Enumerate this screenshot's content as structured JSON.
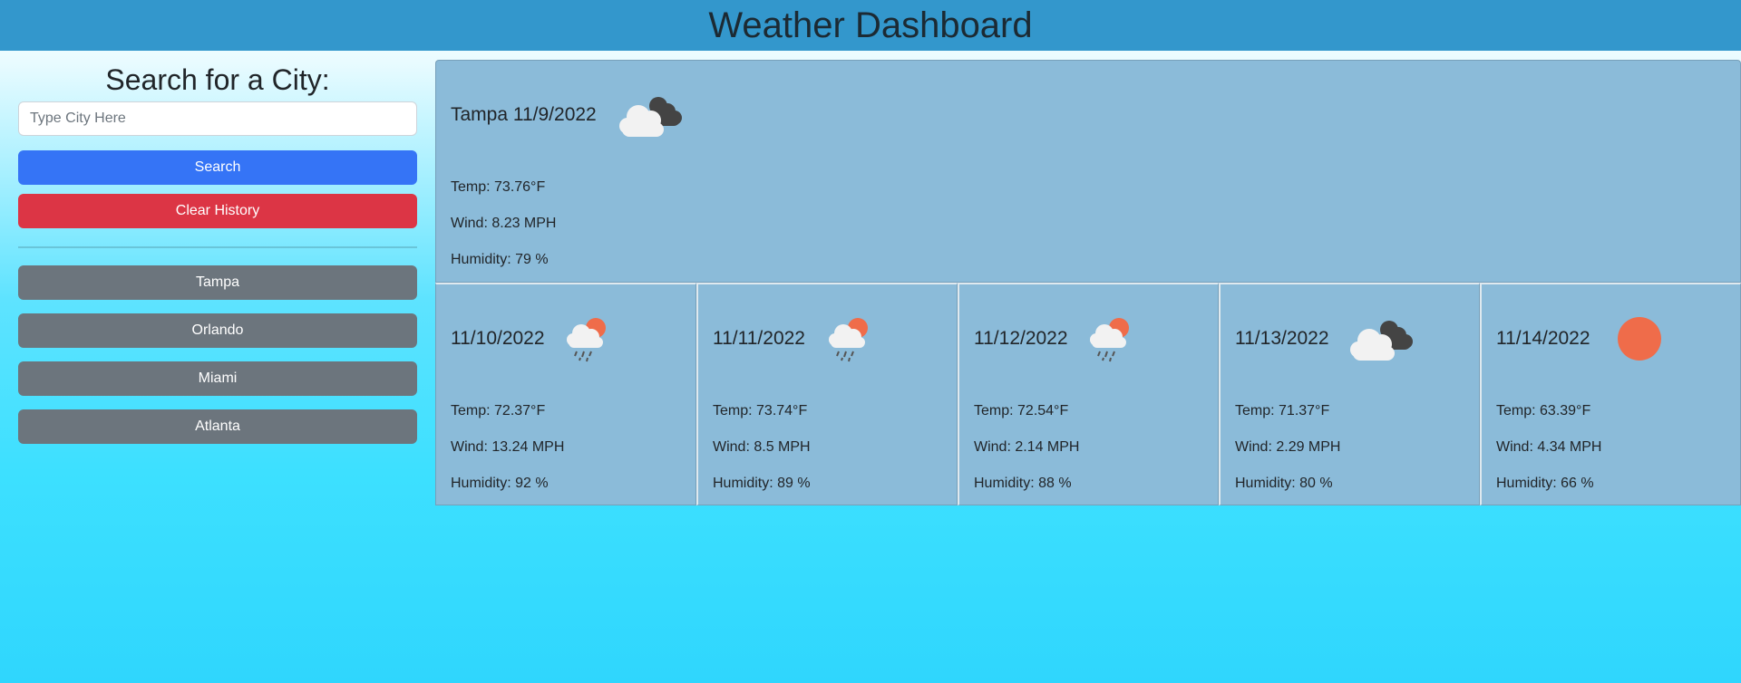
{
  "header": {
    "title": "Weather Dashboard"
  },
  "sidebar": {
    "heading": "Search for a City:",
    "search_placeholder": "Type City Here",
    "search_value": "",
    "search_label": "Search",
    "clear_label": "Clear History",
    "history": [
      "Tampa",
      "Orlando",
      "Miami",
      "Atlanta"
    ]
  },
  "current": {
    "title": "Tampa 11/9/2022",
    "icon": "clouds-icon",
    "temp": "Temp: 73.76°F",
    "wind": "Wind: 8.23 MPH",
    "humidity": "Humidity: 79 %"
  },
  "forecast": [
    {
      "date": "11/10/2022",
      "icon": "rain-icon",
      "temp": "Temp: 72.37°F",
      "wind": "Wind: 13.24 MPH",
      "humidity": "Humidity: 92 %"
    },
    {
      "date": "11/11/2022",
      "icon": "rain-icon",
      "temp": "Temp: 73.74°F",
      "wind": "Wind: 8.5 MPH",
      "humidity": "Humidity: 89 %"
    },
    {
      "date": "11/12/2022",
      "icon": "rain-icon",
      "temp": "Temp: 72.54°F",
      "wind": "Wind: 2.14 MPH",
      "humidity": "Humidity: 88 %"
    },
    {
      "date": "11/13/2022",
      "icon": "clouds-icon",
      "temp": "Temp: 71.37°F",
      "wind": "Wind: 2.29 MPH",
      "humidity": "Humidity: 80 %"
    },
    {
      "date": "11/14/2022",
      "icon": "clear-sun-icon",
      "temp": "Temp: 63.39°F",
      "wind": "Wind: 4.34 MPH",
      "humidity": "Humidity: 66 %"
    }
  ],
  "colors": {
    "header_bg": "#3397cc",
    "card_bg": "#8bbbd9",
    "search_button": "#3574f6",
    "clear_button": "#dc3545",
    "history_button": "#6c757d",
    "sun": "#ef6c4a"
  }
}
